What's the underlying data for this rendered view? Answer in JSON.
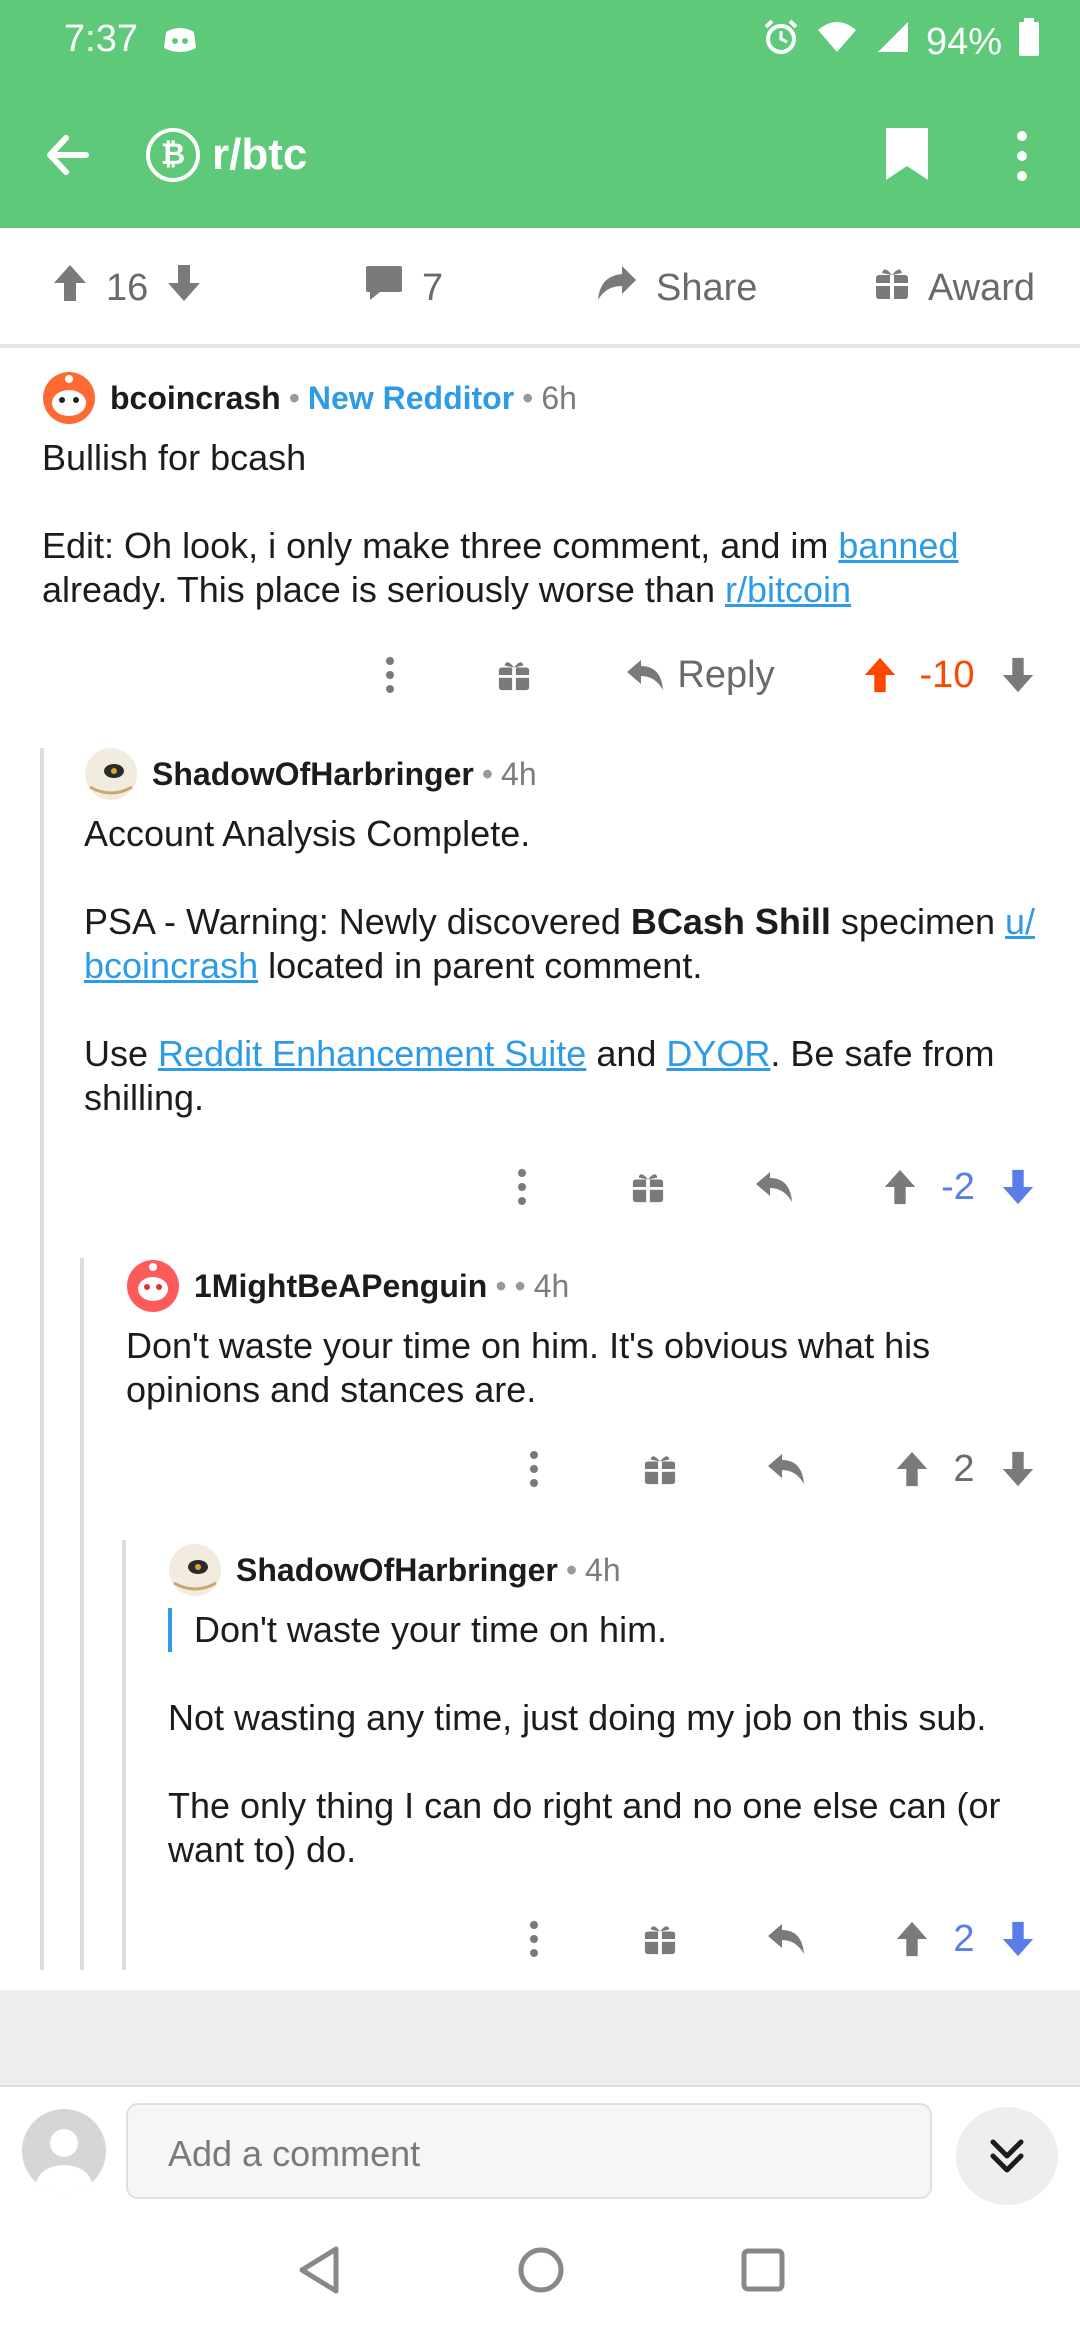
{
  "status": {
    "time": "7:37",
    "battery": "94%"
  },
  "app": {
    "subreddit": "r/btc",
    "sub_icon_glyph": "₿",
    "accent": "#5ec978"
  },
  "post": {
    "upvotes": "16",
    "comments": "7",
    "share_label": "Share",
    "award_label": "Award"
  },
  "comments": [
    {
      "author": "bcoincrash",
      "flair": "New Redditor",
      "age": "6h",
      "lines": {
        "p1": "Bullish for bcash",
        "p2a": "Edit: Oh look, i only make three comment, and im ",
        "p2link1": "banned",
        "p2b": " already. This place is seriously worse than ",
        "p2link2": "r/bitcoin"
      },
      "reply_label": "Reply",
      "score": "-10",
      "score_color": "#ff4500"
    },
    {
      "author": "ShadowOfHarbringer",
      "age": "4h",
      "lines": {
        "p1": "Account Analysis Complete.",
        "p2a": "PSA - Warning: Newly discovered ",
        "p2bold": "BCash Shill",
        "p2b": " specimen ",
        "p2link": "u/ bcoincrash",
        "p2c": " located in parent comment.",
        "p3a": "Use ",
        "p3link1": "Reddit Enhancement Suite",
        "p3b": " and ",
        "p3link2": "DYOR",
        "p3c": ". Be safe from shilling."
      },
      "score": "-2",
      "score_color": "#5a7de8"
    },
    {
      "author": "1MightBeAPenguin",
      "age": "4h",
      "lines": {
        "p1": "Don't waste your time on him. It's obvious what his opinions and stances are."
      },
      "score": "2"
    },
    {
      "author": "ShadowOfHarbringer",
      "age": "4h",
      "lines": {
        "quote": "Don't waste your time on him.",
        "p1": "Not wasting any time, just doing my job on this sub.",
        "p2": "The only thing I can do right and no one else can (or want to) do."
      },
      "score": "2",
      "score_color": "#5a7de8"
    }
  ],
  "composer": {
    "placeholder": "Add a comment"
  }
}
